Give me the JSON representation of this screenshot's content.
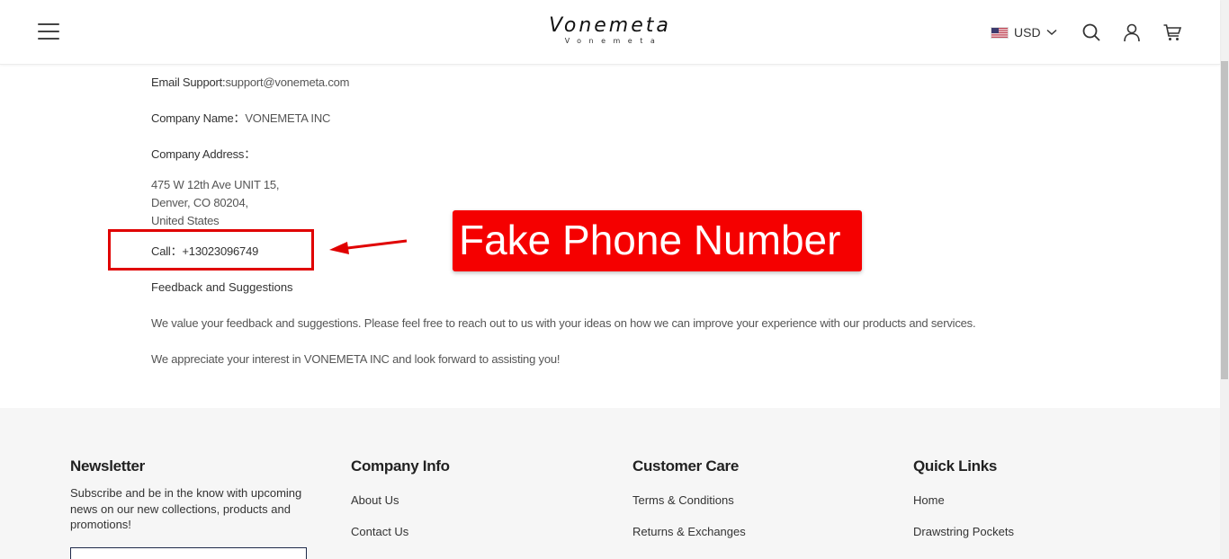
{
  "header": {
    "logo_main": "Vonemeta",
    "logo_sub": "Vonemeta",
    "currency": "USD"
  },
  "contact": {
    "email_label": "Email Support:",
    "email_value": "support@vonemeta.com",
    "company_label": "Company Name：",
    "company_value": "VONEMETA INC",
    "address_label": "Company Address：",
    "address_lines": [
      "475 W 12th Ave UNIT 15,",
      "Denver, CO 80204,",
      "United States"
    ],
    "call_label": "Call：",
    "call_value": "+13023096749",
    "feedback_heading": "Feedback and Suggestions",
    "feedback_text": "We value your feedback and suggestions. Please feel free to reach out to us with your ideas on how we can improve your experience with our products and services.",
    "closing_text": "We appreciate your interest in VONEMETA INC and look forward to assisting you!"
  },
  "annotation": {
    "label": "Fake Phone Number",
    "color": "#f50000"
  },
  "footer": {
    "newsletter": {
      "title": "Newsletter",
      "text": "Subscribe and be in the know with upcoming news on our new collections, products and promotions!"
    },
    "company_info": {
      "title": "Company Info",
      "links": [
        "About Us",
        "Contact Us"
      ]
    },
    "customer_care": {
      "title": "Customer Care",
      "links": [
        "Terms & Conditions",
        "Returns & Exchanges"
      ]
    },
    "quick_links": {
      "title": "Quick Links",
      "links": [
        "Home",
        "Drawstring Pockets"
      ]
    }
  }
}
